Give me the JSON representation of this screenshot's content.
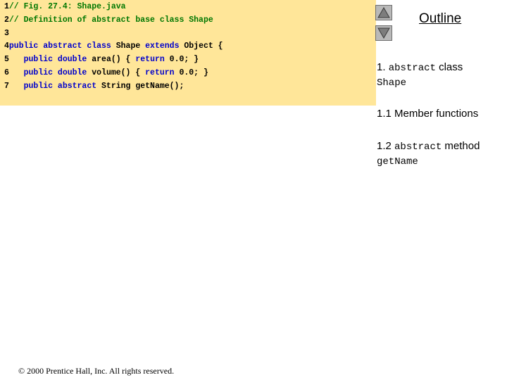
{
  "code": {
    "lines": [
      {
        "n": "1",
        "parts": [
          {
            "cls": "cm",
            "text": "// Fig. 27.4: Shape.java"
          }
        ]
      },
      {
        "n": "2",
        "parts": [
          {
            "cls": "cm",
            "text": "// Definition of abstract base class Shape"
          }
        ]
      },
      {
        "n": "3",
        "parts": []
      },
      {
        "n": "4",
        "parts": [
          {
            "cls": "kw",
            "text": "public abstract class "
          },
          {
            "cls": "tx",
            "text": "Shape "
          },
          {
            "cls": "kw",
            "text": "extends "
          },
          {
            "cls": "tx",
            "text": "Object {"
          }
        ]
      },
      {
        "n": "5",
        "parts": [
          {
            "cls": "kw",
            "text": "   public double "
          },
          {
            "cls": "tx",
            "text": "area() { "
          },
          {
            "cls": "kw",
            "text": "return "
          },
          {
            "cls": "tx",
            "text": "0.0; }"
          }
        ]
      },
      {
        "n": "6",
        "parts": [
          {
            "cls": "kw",
            "text": "   public double "
          },
          {
            "cls": "tx",
            "text": "volume() { "
          },
          {
            "cls": "kw",
            "text": "return "
          },
          {
            "cls": "tx",
            "text": "0.0; }"
          }
        ]
      },
      {
        "n": "7",
        "parts": [
          {
            "cls": "kw",
            "text": "   public abstract "
          },
          {
            "cls": "tx",
            "text": "String getName();"
          }
        ]
      }
    ]
  },
  "outline": {
    "title": "Outline",
    "item1_num": "1. ",
    "item1_mono": "abstract",
    "item1_text": " class",
    "item1_mono2": "Shape",
    "item2": "1.1 Member functions",
    "item3_text": "1.2 ",
    "item3_mono": "abstract",
    "item3_text2": " method",
    "item3_mono2": "getName"
  },
  "nav": {
    "up_icon": "triangle-up-icon",
    "down_icon": "triangle-down-icon"
  },
  "footer": {
    "copyright": "© 2000 Prentice Hall, Inc.  All rights reserved."
  }
}
